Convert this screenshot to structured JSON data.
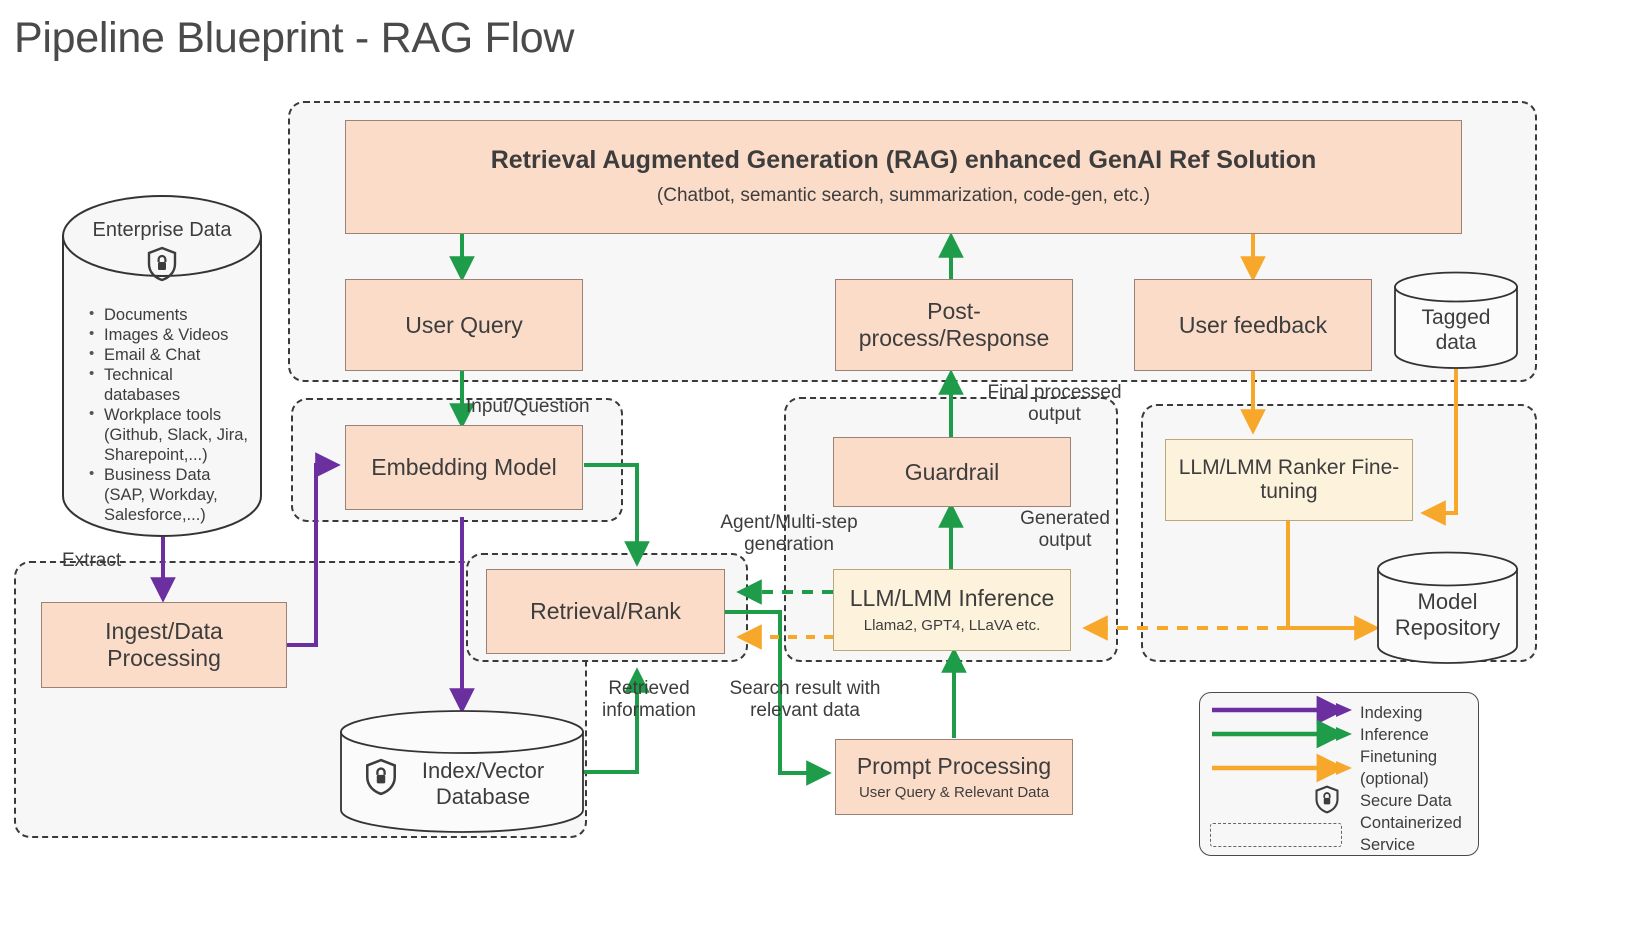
{
  "page": {
    "title": "Pipeline Blueprint - RAG Flow"
  },
  "colors": {
    "indexing": "#6b2fa0",
    "inference": "#1e9c4a",
    "finetuning": "#f7a82b",
    "node_fill": "#fbdcc9",
    "node_stroke": "#9b8276",
    "yellow_fill": "#fdf2dc",
    "yellow_stroke": "#b9a87e",
    "zone_bg": "#f7f7f7",
    "text": "#3d3d3d"
  },
  "enterprise_data": {
    "title": "Enterprise Data",
    "icon": "shield-lock-icon",
    "bullets": [
      "Documents",
      "Images & Videos",
      "Email & Chat",
      "Technical databases",
      "Workplace tools (Github, Slack, Jira, Sharepoint,...)",
      "Business Data (SAP, Workday, Salesforce,...)"
    ]
  },
  "zones": {
    "rag": {
      "label": ""
    },
    "extract": {
      "label": "Extract"
    },
    "embedding": {
      "label": ""
    },
    "retrieval": {
      "label": ""
    },
    "inference": {
      "label": ""
    },
    "finetune": {
      "label": ""
    }
  },
  "nodes": {
    "rag_solution": {
      "title": "Retrieval Augmented Generation (RAG) enhanced GenAI Ref Solution",
      "subtitle": "(Chatbot, semantic search, summarization, code-gen, etc.)"
    },
    "user_query": {
      "title": "User Query"
    },
    "post_process": {
      "title": "Post-process/Response"
    },
    "user_feedback": {
      "title": "User feedback"
    },
    "embedding_model": {
      "title": "Embedding Model"
    },
    "guardrail": {
      "title": "Guardrail"
    },
    "ranker_finetune": {
      "title": "LLM/LMM Ranker Fine-tuning"
    },
    "ingest": {
      "title": "Ingest/Data Processing"
    },
    "retrieval_rank": {
      "title": "Retrieval/Rank"
    },
    "llm_inference": {
      "title": "LLM/LMM Inference",
      "subtitle": "Llama2, GPT4, LLaVA etc."
    },
    "prompt_processing": {
      "title": "Prompt Processing",
      "subtitle": "User Query & Relevant Data"
    }
  },
  "cylinders": {
    "tagged_data": {
      "title": "Tagged data"
    },
    "model_repository": {
      "title": "Model Repository"
    },
    "index_vector_db": {
      "title": "Index/Vector Database",
      "icon": "shield-lock-icon"
    }
  },
  "edge_labels": {
    "extract": "Extract",
    "input_question": "Input/Question",
    "final_processed_output": "Final processed output",
    "agent_multi_step": "Agent/Multi-step generation",
    "generated_output": "Generated output",
    "retrieved_information": "Retrieved information",
    "search_result": "Search result with relevant data"
  },
  "legend": {
    "items": [
      {
        "type": "arrow",
        "color_key": "indexing",
        "label": "Indexing"
      },
      {
        "type": "arrow",
        "color_key": "inference",
        "label": "Inference"
      },
      {
        "type": "arrow",
        "color_key": "finetuning",
        "label": "Finetuning"
      },
      {
        "type": "text",
        "label": "(optional)"
      },
      {
        "type": "shield",
        "label": "Secure Data"
      },
      {
        "type": "text",
        "label": "Containerized"
      },
      {
        "type": "dashbox",
        "label": "Service"
      }
    ],
    "lines": [
      "Indexing",
      "Inference",
      "Finetuning",
      "(optional)",
      "Secure Data",
      "Containerized",
      "Service"
    ]
  }
}
